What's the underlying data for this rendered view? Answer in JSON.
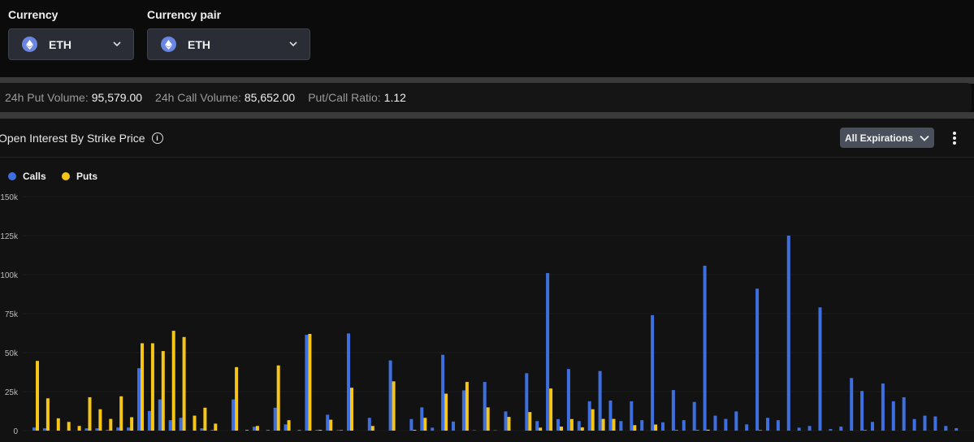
{
  "filters": {
    "currency_label": "Currency",
    "currency_value": "ETH",
    "pair_label": "Currency pair",
    "pair_value": "ETH"
  },
  "stats": {
    "put_volume_label": "24h Put Volume:",
    "put_volume": "95,579.00",
    "call_volume_label": "24h Call Volume:",
    "call_volume": "85,652.00",
    "ratio_label": "Put/Call Ratio:",
    "ratio": "1.12"
  },
  "panel": {
    "title": "Open Interest By Strike Price",
    "expirations_label": "All Expirations"
  },
  "colors": {
    "calls": "#3d6fe0",
    "puts": "#f5c518"
  },
  "chart_data": {
    "type": "bar",
    "title": "Open Interest By Strike Price",
    "ylim": [
      0,
      150000
    ],
    "yticks": [
      "0",
      "25k",
      "50k",
      "75k",
      "100k",
      "125k",
      "150k"
    ],
    "ytick_values": [
      0,
      25000,
      50000,
      75000,
      100000,
      125000,
      150000
    ],
    "legend": [
      "Calls",
      "Puts"
    ],
    "legend_position": "top-left",
    "series": [
      {
        "name": "Calls",
        "values": [
          2000,
          1500,
          0,
          0,
          0,
          1500,
          1500,
          500,
          2000,
          2000,
          40000,
          12600,
          20000,
          6700,
          8200,
          0,
          1500,
          500,
          0,
          20000,
          0,
          2500,
          0,
          14700,
          4000,
          0,
          61400,
          500,
          10200,
          300,
          62300,
          0,
          8200,
          0,
          45000,
          0,
          7400,
          14900,
          1900,
          48600,
          5800,
          25800,
          300,
          31200,
          300,
          12300,
          0,
          36800,
          6100,
          101000,
          7400,
          39500,
          6100,
          18800,
          38200,
          19300,
          6100,
          18800,
          6700,
          74000,
          5300,
          26000,
          6700,
          18400,
          105700,
          9600,
          7500,
          12300,
          4000,
          91000,
          8200,
          6700,
          125000,
          1900,
          3000,
          79000,
          1000,
          2600,
          33700,
          25400,
          5600,
          30200,
          18800,
          21400,
          7400,
          9600,
          9100,
          3000,
          1600
        ]
      },
      {
        "name": "Puts",
        "values": [
          44700,
          20700,
          7900,
          5600,
          3000,
          21400,
          13700,
          7500,
          22000,
          8600,
          56000,
          56000,
          51000,
          64000,
          60000,
          9600,
          14700,
          4500,
          0,
          40700,
          400,
          3000,
          300,
          41800,
          6700,
          300,
          62000,
          500,
          7000,
          300,
          27500,
          0,
          3000,
          0,
          31600,
          0,
          500,
          8200,
          0,
          23700,
          0,
          31200,
          0,
          14900,
          0,
          8800,
          0,
          11900,
          1900,
          27000,
          2600,
          7400,
          2100,
          13700,
          7500,
          7500,
          0,
          3500,
          0,
          3900,
          0,
          300,
          0,
          300,
          600,
          0,
          0,
          0,
          0,
          300,
          0,
          0,
          0,
          0,
          0,
          0,
          0,
          0,
          0,
          300,
          0,
          0,
          0,
          0,
          0,
          0,
          0,
          0,
          0
        ]
      }
    ]
  }
}
